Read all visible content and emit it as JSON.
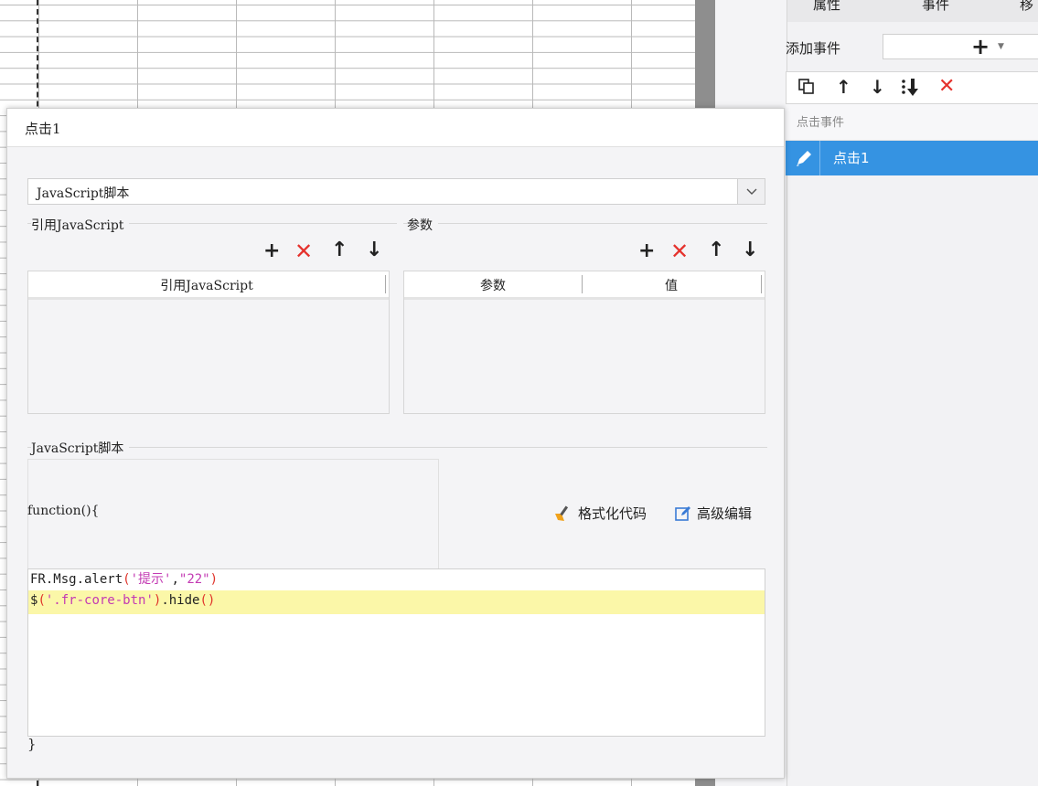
{
  "right_panel": {
    "tabs": [
      {
        "label": "属性"
      },
      {
        "label": "事件"
      },
      {
        "label": "移"
      }
    ],
    "add_event_label": "添加事件",
    "event_section_label": "点击事件",
    "event_items": [
      {
        "label": "点击1"
      }
    ]
  },
  "dialog": {
    "title": "点击1",
    "type_select": {
      "value": "JavaScript脚本"
    },
    "ref_js_group": {
      "title": "引用JavaScript",
      "columns": [
        "引用JavaScript"
      ]
    },
    "params_group": {
      "title": "参数",
      "columns": [
        "参数",
        "值"
      ]
    },
    "script_group": {
      "title": "JavaScript脚本",
      "fn_header": "function(){",
      "format_code": "格式化代码",
      "advanced_edit": "高级编辑",
      "code": {
        "line1": {
          "fn": "FR.Msg.alert",
          "p1": "(",
          "s1": "'提示'",
          "comma": ",",
          "s2": "\"22\"",
          "p2": ")"
        },
        "line2": {
          "fn1": "$",
          "p1": "(",
          "s1": "'.fr-core-btn'",
          "p2": ")",
          "fn2": ".hide",
          "p3": "()"
        }
      },
      "fn_footer": "}"
    }
  }
}
